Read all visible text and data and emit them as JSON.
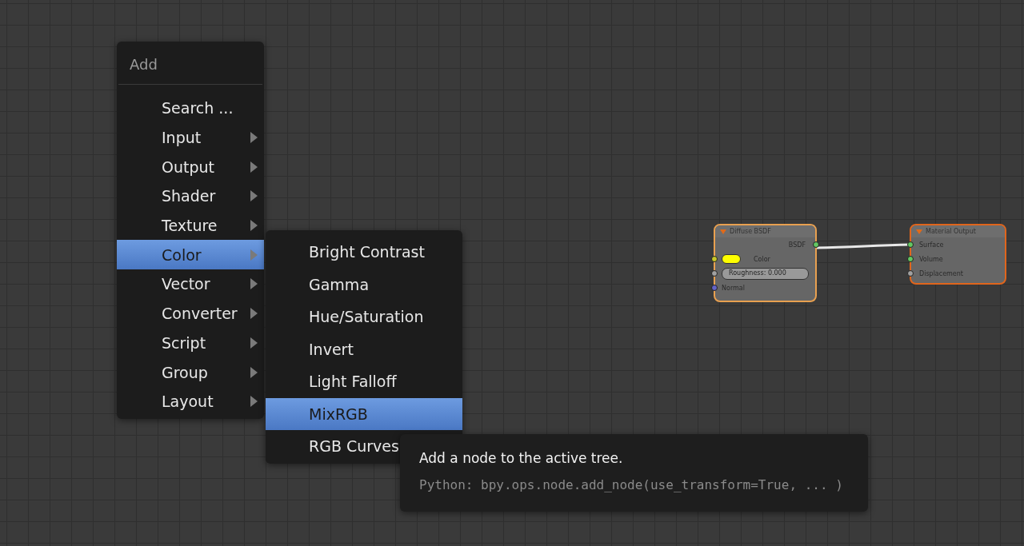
{
  "add_menu": {
    "title": "Add",
    "items": [
      {
        "label": "Search ...",
        "has_submenu": false,
        "selected": false
      },
      {
        "label": "Input",
        "has_submenu": true,
        "selected": false
      },
      {
        "label": "Output",
        "has_submenu": true,
        "selected": false
      },
      {
        "label": "Shader",
        "has_submenu": true,
        "selected": false
      },
      {
        "label": "Texture",
        "has_submenu": true,
        "selected": false
      },
      {
        "label": "Color",
        "has_submenu": true,
        "selected": true
      },
      {
        "label": "Vector",
        "has_submenu": true,
        "selected": false
      },
      {
        "label": "Converter",
        "has_submenu": true,
        "selected": false
      },
      {
        "label": "Script",
        "has_submenu": true,
        "selected": false
      },
      {
        "label": "Group",
        "has_submenu": true,
        "selected": false
      },
      {
        "label": "Layout",
        "has_submenu": true,
        "selected": false
      }
    ]
  },
  "color_submenu": {
    "items": [
      {
        "label": "Bright Contrast",
        "selected": false
      },
      {
        "label": "Gamma",
        "selected": false
      },
      {
        "label": "Hue/Saturation",
        "selected": false
      },
      {
        "label": "Invert",
        "selected": false
      },
      {
        "label": "Light Falloff",
        "selected": false
      },
      {
        "label": "MixRGB",
        "selected": true
      },
      {
        "label": "RGB Curves",
        "selected": false
      }
    ]
  },
  "tooltip": {
    "description": "Add a node to the active tree.",
    "python": "Python: bpy.ops.node.add_node(use_transform=True, ... )"
  },
  "nodes": [
    {
      "title": "Diffuse BSDF",
      "outputs": [
        {
          "label": "BSDF",
          "color": "#63c763"
        }
      ],
      "inputs": [
        {
          "kind": "color",
          "label": "Color",
          "color": "#c7c729"
        },
        {
          "kind": "value",
          "label": "Roughness: 0.000",
          "color": "#a1a1a1"
        },
        {
          "kind": "plain",
          "label": "Normal",
          "color": "#6363c7"
        }
      ]
    },
    {
      "title": "Material Output",
      "inputs": [
        {
          "kind": "plain",
          "label": "Surface",
          "color": "#63c763"
        },
        {
          "kind": "plain",
          "label": "Volume",
          "color": "#63c763"
        },
        {
          "kind": "plain",
          "label": "Displacement",
          "color": "#a1a1a1"
        }
      ]
    }
  ]
}
